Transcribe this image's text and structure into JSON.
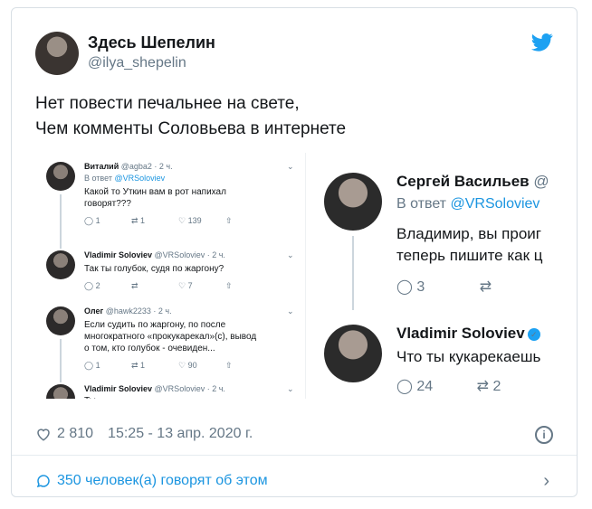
{
  "author": {
    "name": "Здесь Шепелин",
    "handle": "@ilya_shepelin"
  },
  "tweet": {
    "line1": "Нет повести печальнее на свете,",
    "line2": "Чем комменты Соловьева в интернете"
  },
  "screenshot_left": {
    "t1": {
      "name": "Виталий",
      "meta": "@agba2 · 2 ч.",
      "reply_prefix": "В ответ",
      "reply_to": "@VRSoloviev",
      "text1": "Какой то Уткин вам в рот напихал",
      "text2": "говорят???",
      "replies": "1",
      "retweets": "1",
      "likes": "139"
    },
    "t2": {
      "name": "Vladimir Soloviev",
      "meta": "@VRSoloviev · 2 ч.",
      "text1": "Так ты голубок, судя по жаргону?",
      "replies": "2",
      "retweets": "",
      "likes": "7"
    },
    "t3": {
      "name": "Олег",
      "meta": "@hawk2233 · 2 ч.",
      "text1": "Если судить по жаргону, по после",
      "text2": "многократного «прокукарекал»(с), вывод",
      "text3": "о том, кто голубок - очевиден...",
      "replies": "1",
      "retweets": "1",
      "likes": "90"
    },
    "t4": {
      "name": "Vladimir Soloviev",
      "meta": "@VRSoloviev · 2 ч.",
      "text1": "Ты"
    }
  },
  "screenshot_right": {
    "t1": {
      "name": "Сергей Васильев",
      "meta": "@",
      "reply_prefix": "В ответ",
      "reply_to": "@VRSoloviev",
      "text1": "Владимир, вы проиг",
      "text2": "теперь пишите как ц",
      "replies": "3",
      "retweets": ""
    },
    "t2": {
      "name": "Vladimir Soloviev",
      "text1": "Что ты кукарекаешь",
      "replies": "24",
      "retweets": "2"
    }
  },
  "footer": {
    "likes": "2 810",
    "time": "15:25 - 13 апр. 2020 г.",
    "comments": "350 человек(а) говорят об этом"
  },
  "colors": {
    "accent": "#1da1f2",
    "link": "#1b95e0",
    "muted": "#657786",
    "text": "#14171a"
  },
  "icons": [
    "twitter-bird-icon",
    "verified-icon",
    "reply-icon",
    "retweet-icon",
    "like-icon",
    "share-icon",
    "info-icon",
    "comment-icon",
    "chevron-right-icon"
  ]
}
